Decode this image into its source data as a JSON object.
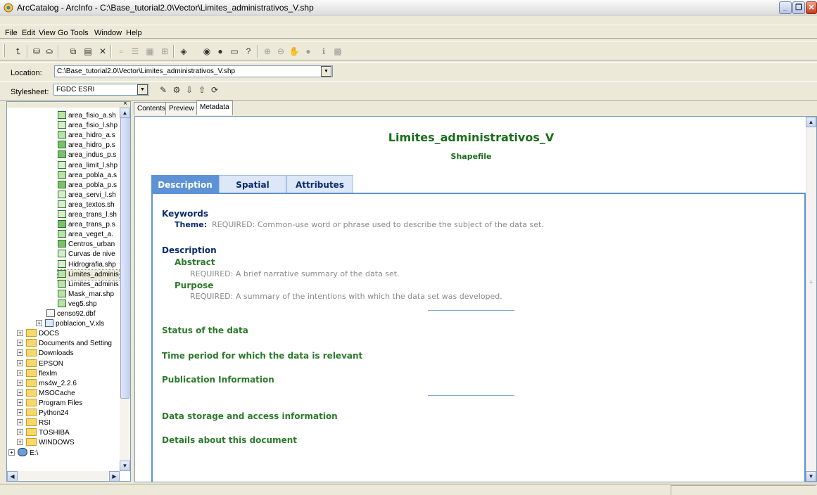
{
  "window": {
    "title": "ArcCatalog - ArcInfo - C:\\Base_tutorial2.0\\Vector\\Limites_administrativos_V.shp",
    "min": "_",
    "max": "❐",
    "close": "✕"
  },
  "menu": [
    "File",
    "Edit",
    "View",
    "Go",
    "Tools",
    "Window",
    "Help"
  ],
  "location": {
    "label": "Location:",
    "value": "C:\\Base_tutorial2.0\\Vector\\Limites_administrativos_V.shp"
  },
  "stylesheet": {
    "label": "Stylesheet:",
    "value": "FGDC ESRI"
  },
  "tree": {
    "items": [
      {
        "label": "area_fisio_a.sh",
        "icon": "poly"
      },
      {
        "label": "area_fisio_l.shp",
        "icon": "line"
      },
      {
        "label": "area_hidro_a.s",
        "icon": "poly"
      },
      {
        "label": "area_hidro_p.s",
        "icon": "point"
      },
      {
        "label": "area_indus_p.s",
        "icon": "point"
      },
      {
        "label": "area_limit_l.shp",
        "icon": "line"
      },
      {
        "label": "area_pobla_a.s",
        "icon": "poly"
      },
      {
        "label": "area_pobla_p.s",
        "icon": "point"
      },
      {
        "label": "area_servi_l.sh",
        "icon": "line"
      },
      {
        "label": "area_textos.sh",
        "icon": "line"
      },
      {
        "label": "area_trans_l.sh",
        "icon": "line"
      },
      {
        "label": "area_trans_p.s",
        "icon": "point"
      },
      {
        "label": "area_veget_a.",
        "icon": "poly"
      },
      {
        "label": "Centros_urban",
        "icon": "point"
      },
      {
        "label": "Curvas de nive",
        "icon": "line"
      },
      {
        "label": "Hidrografia.shp",
        "icon": "line"
      },
      {
        "label": "Limites_adminis",
        "icon": "poly",
        "selected": true
      },
      {
        "label": "Limites_adminis",
        "icon": "poly"
      },
      {
        "label": "Mask_mar.shp",
        "icon": "poly"
      },
      {
        "label": "veg5.shp",
        "icon": "poly"
      }
    ],
    "table_item": "censo92.dbf",
    "xls_item": "poblacion_V.xls",
    "folders": [
      "DOCS",
      "Documents and Setting",
      "Downloads",
      "EPSON",
      "flexlm",
      "ms4w_2.2.6",
      "MSOCache",
      "Program Files",
      "Python24",
      "RSI",
      "TOSHIBA",
      "WINDOWS"
    ],
    "drive": "E:\\"
  },
  "content_tabs": [
    "Contents",
    "Preview",
    "Metadata"
  ],
  "metadata": {
    "title": "Limites_administrativos_V",
    "subtitle": "Shapefile",
    "tabs": [
      "Description",
      "Spatial",
      "Attributes"
    ],
    "keywords_head": "Keywords",
    "theme_label": "Theme:",
    "theme_text": "REQUIRED: Common-use word or phrase used to describe the subject of the data set.",
    "description_head": "Description",
    "abstract_head": "Abstract",
    "abstract_text": "REQUIRED: A brief narrative summary of the data set.",
    "purpose_head": "Purpose",
    "purpose_text": "REQUIRED: A summary of the intentions with which the data set was developed.",
    "sections": [
      "Status of the data",
      "Time period for which the data is relevant",
      "Publication Information",
      "Data storage and access information",
      "Details about this document"
    ]
  },
  "colors": {
    "accent": "#5d92d6",
    "green": "#1a6e1a",
    "navy": "#0b2a6b"
  }
}
